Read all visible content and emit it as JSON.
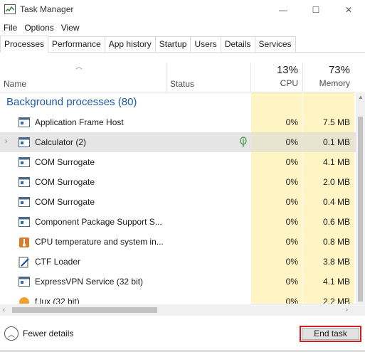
{
  "window": {
    "title": "Task Manager",
    "min_glyph": "—",
    "max_glyph": "☐",
    "close_glyph": "✕"
  },
  "menu": [
    "File",
    "Options",
    "View"
  ],
  "tabs": [
    "Processes",
    "Performance",
    "App history",
    "Startup",
    "Users",
    "Details",
    "Services"
  ],
  "active_tab": "Processes",
  "columns": {
    "name": "Name",
    "status": "Status",
    "cpu_percent": "13%",
    "cpu_label": "CPU",
    "memory_percent": "73%",
    "memory_label": "Memory"
  },
  "group": {
    "label": "Background processes (80)"
  },
  "processes": [
    {
      "name": "Application Frame Host",
      "cpu": "0%",
      "memory": "7.5 MB",
      "icon": "window-app-icon"
    },
    {
      "name": "Calculator (2)",
      "cpu": "0%",
      "memory": "0.1 MB",
      "icon": "window-app-icon",
      "expandable": true,
      "selected": true,
      "status_icon": "leaf-suspended-icon"
    },
    {
      "name": "COM Surrogate",
      "cpu": "0%",
      "memory": "4.1 MB",
      "icon": "window-app-icon"
    },
    {
      "name": "COM Surrogate",
      "cpu": "0%",
      "memory": "2.0 MB",
      "icon": "window-app-icon"
    },
    {
      "name": "COM Surrogate",
      "cpu": "0%",
      "memory": "0.4 MB",
      "icon": "window-app-icon"
    },
    {
      "name": "Component Package Support S...",
      "cpu": "0%",
      "memory": "0.6 MB",
      "icon": "window-app-icon"
    },
    {
      "name": "CPU temperature and system in...",
      "cpu": "0%",
      "memory": "0.8 MB",
      "icon": "thermometer-app-icon"
    },
    {
      "name": "CTF Loader",
      "cpu": "0%",
      "memory": "3.8 MB",
      "icon": "pen-app-icon"
    },
    {
      "name": "ExpressVPN Service (32 bit)",
      "cpu": "0%",
      "memory": "4.1 MB",
      "icon": "window-app-icon"
    },
    {
      "name": "f.lux (32 bit)",
      "cpu": "0%",
      "memory": "2.2 MB",
      "icon": "flux-app-icon"
    }
  ],
  "footer": {
    "fewer_details": "Fewer details",
    "end_task": "End task"
  },
  "colors": {
    "heat_cell": "#fff4c4",
    "group_text": "#1f5aa6",
    "highlight_outline": "#d31c1c"
  }
}
